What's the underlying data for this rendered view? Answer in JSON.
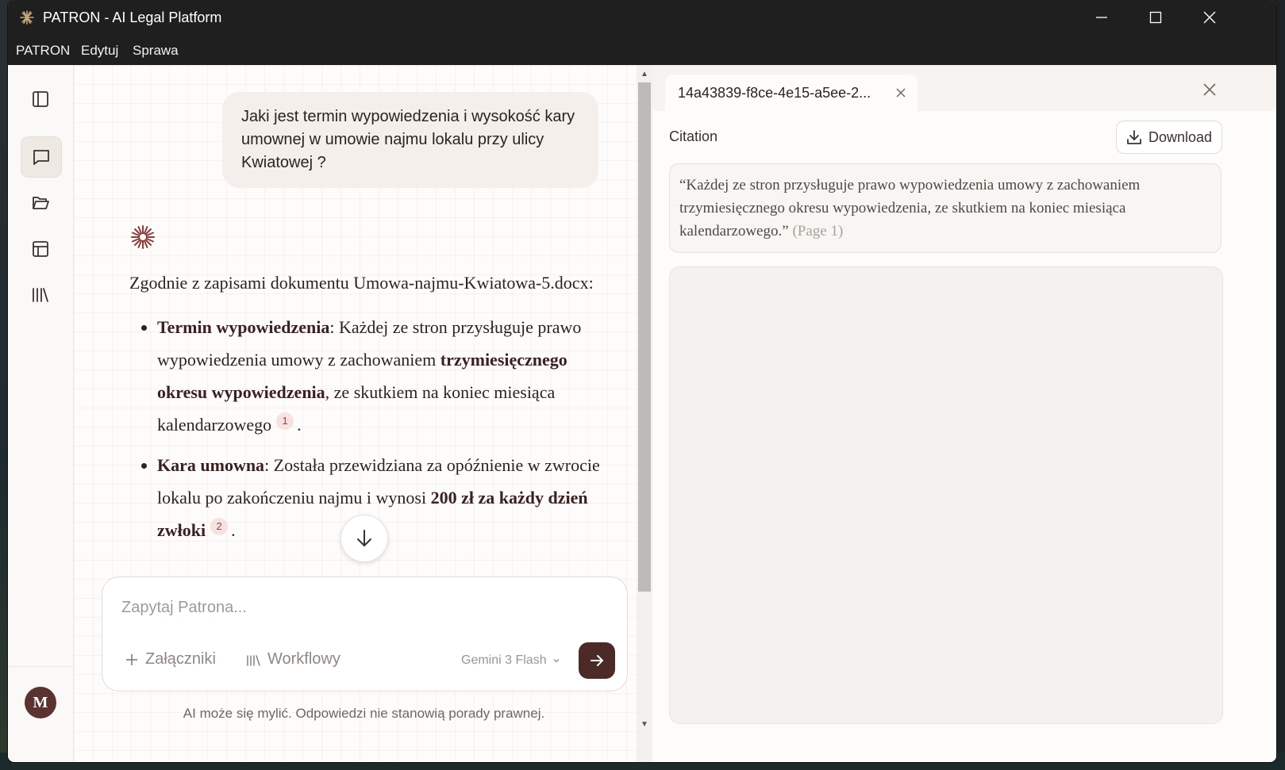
{
  "window": {
    "title": "PATRON - AI Legal Platform"
  },
  "menu": [
    "PATRON",
    "Edytuj",
    "Sprawa"
  ],
  "rail": {
    "avatar_letter": "M"
  },
  "chat": {
    "user_message": "Jaki jest termin wypowiedzenia i wysokość kary umownej w umowie najmu lokalu przy ulicy Kwiatowej ?",
    "answer_intro": "Zgodnie z zapisami dokumentu Umowa-najmu-Kwiatowa-5.docx:",
    "bullets": [
      {
        "label": "Termin wypowiedzenia",
        "text1": ": Każdej ze stron przysługuje prawo wypowiedzenia umowy z zachowaniem ",
        "bold2": "trzymiesięcznego okresu wypowiedzenia",
        "text2": ", ze skutkiem na koniec miesiąca kalendarzowego",
        "citation": "1",
        "end": "."
      },
      {
        "label": "Kara umowna",
        "text1": ": Została przewidziana za opóźnienie w zwrocie lokalu po zakończeniu najmu i wynosi ",
        "bold2": "200 zł za każdy dzień zwłoki",
        "text2": "",
        "citation": "2",
        "end": "."
      }
    ],
    "composer": {
      "placeholder": "Zapytaj Patrona...",
      "attachments_label": "Załączniki",
      "workflows_label": "Workflowy",
      "model": "Gemini 3 Flash"
    },
    "disclaimer": "AI może się mylić. Odpowiedzi nie stanowią porady prawnej."
  },
  "panel": {
    "tab_label": "14a43839-f8ce-4e15-a5ee-2...",
    "citation_title": "Citation",
    "download_label": "Download",
    "quote": "“Każdej ze stron przysługuje prawo wypowiedzenia umowy z zachowaniem trzymiesięcznego okresu wypowiedzenia, ze skutkiem na koniec miesiąca kalendarzowego.”",
    "quote_page": "(Page 1)"
  },
  "colors": {
    "accent": "#4b2a27",
    "citation_bg": "#f7e2e2",
    "titlebar": "#1f1f1f"
  }
}
